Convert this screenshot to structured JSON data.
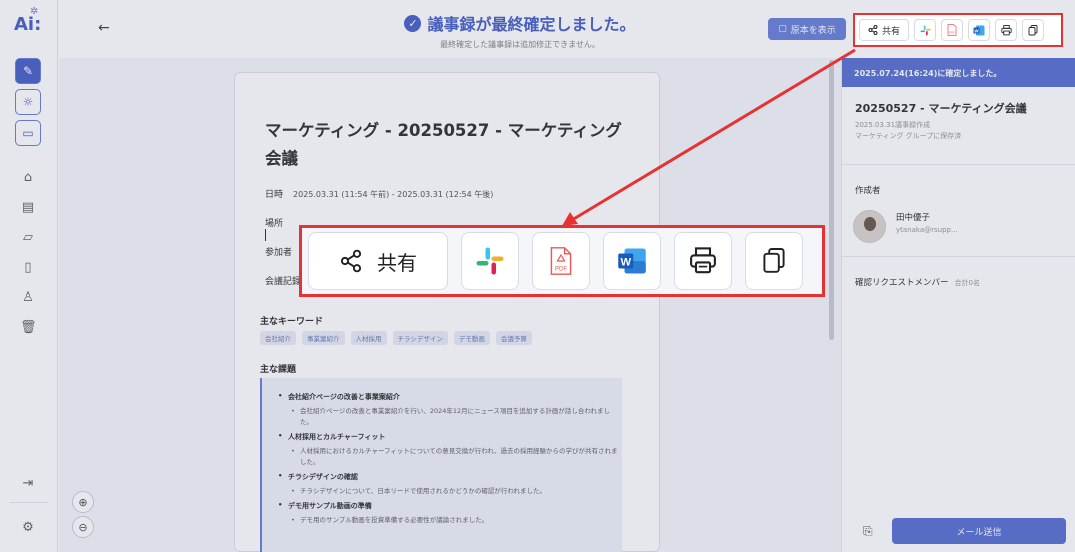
{
  "rail": {
    "logo": "Ai:",
    "items": [
      "edit",
      "sun",
      "chat",
      "home",
      "file",
      "folder",
      "book",
      "person",
      "trash",
      "logout",
      "settings"
    ]
  },
  "header": {
    "back_icon": "←",
    "banner_title": "議事録が最終確定しました。",
    "banner_sub": "最終確定した議事録は追加修正できません。",
    "original_button": "原本を表示"
  },
  "toolbar": {
    "share_label": "共有",
    "icons": [
      "share-icon",
      "slack-icon",
      "pdf-icon",
      "word-icon",
      "print-icon",
      "copy-icon"
    ]
  },
  "doc": {
    "title": "マーケティング - 20250527 - マーケティング会議",
    "date_label": "日時",
    "date_value": "2025.03.31 (11:54 午前) - 2025.03.31 (12:54 午後)",
    "place_label": "場所",
    "attendees_label": "参加者",
    "recorder_label": "会議記録",
    "keywords_label": "主なキーワード",
    "keywords": [
      "会社紹介",
      "事業案紹介",
      "人材採用",
      "チラシデザイン",
      "デモ動画",
      "会議予算"
    ],
    "issues_label": "主な課題",
    "issues": [
      {
        "title": "会社紹介ページの改善と事業案紹介",
        "detail": "会社紹介ページの改善と事業案紹介を行い、2024年12月にニュース項目を追加する計画が話し合われました。"
      },
      {
        "title": "人材採用とカルチャーフィット",
        "detail": "人材採用におけるカルチャーフィットについての意見交換が行われ、過去の採用経験からの学びが共有されました。"
      },
      {
        "title": "チラシデザインの確認",
        "detail": "チラシデザインについて、日本リードで使用されるかどうかの確認が行われました。"
      },
      {
        "title": "デモ用サンプル動画の準備",
        "detail": "デモ用のサンプル動画を投資準備する必要性が議論されました。"
      }
    ]
  },
  "panel": {
    "confirm_banner": "2025.07.24(16:24)に確定しました。",
    "title": "20250527 - マーケティング会議",
    "meta1": "2025.03.31議事録作成",
    "meta2": "マーケティング グループに保存済",
    "creator_label": "作成者",
    "creator_name": "田中優子",
    "creator_mail": "ytanaka@rsupp...",
    "request_label": "確認リクエストメンバー",
    "request_count": "合計0名",
    "send_button": "メール送信"
  },
  "colors": {
    "accent": "#4a63c8",
    "highlight": "#e63232"
  }
}
